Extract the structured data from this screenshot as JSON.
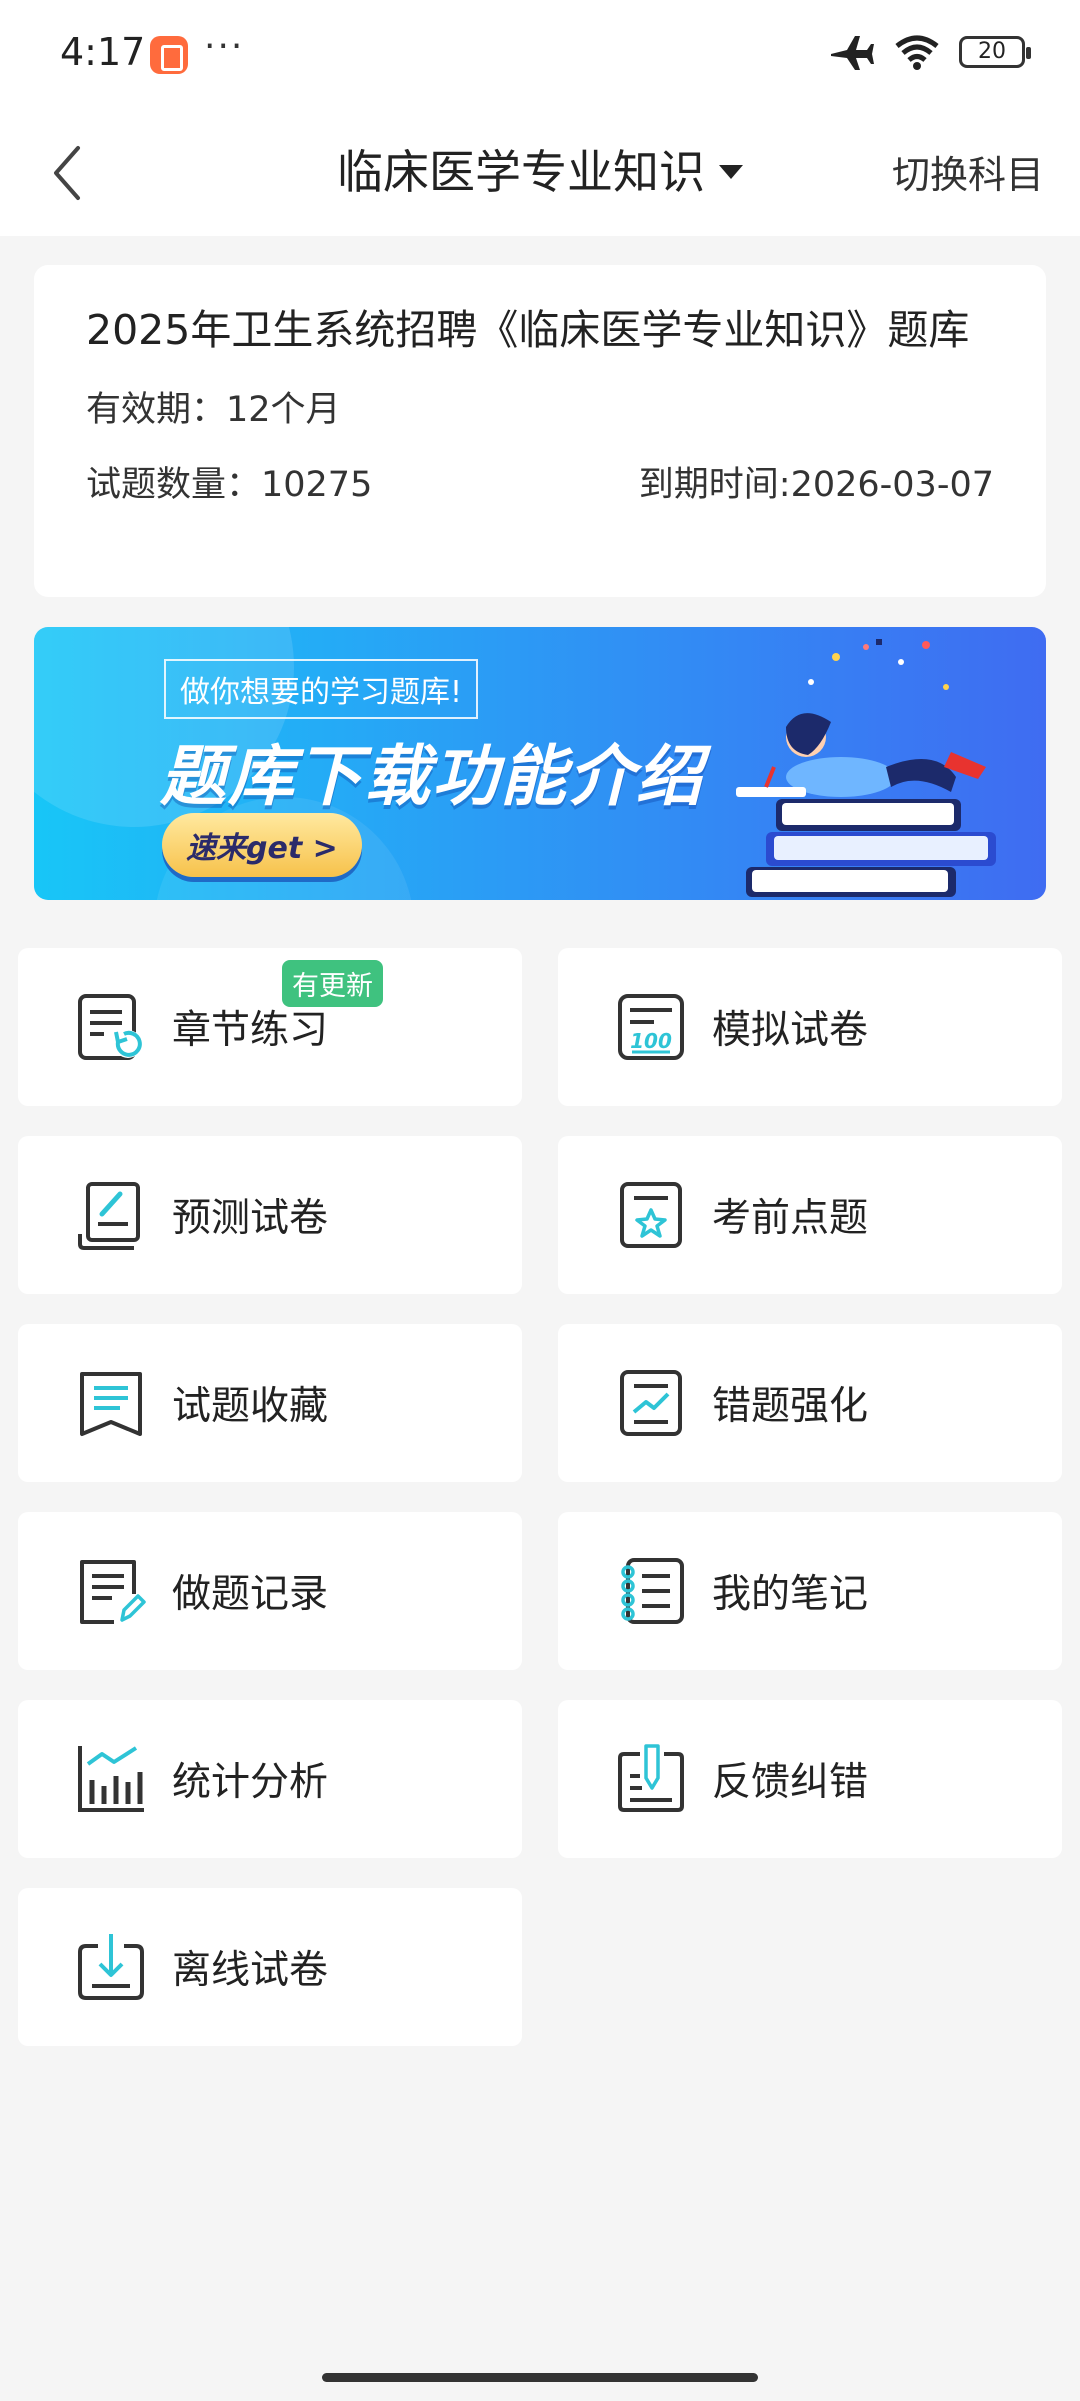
{
  "status_bar": {
    "time": "4:17",
    "dots": "···",
    "battery": "20"
  },
  "nav": {
    "title": "临床医学专业知识",
    "switch_label": "切换科目"
  },
  "info": {
    "title": "2025年卫生系统招聘《临床医学专业知识》题库",
    "validity": "有效期：12个月",
    "count": "试题数量：10275",
    "expiry": "到期时间:2026-03-07"
  },
  "banner": {
    "tag": "做你想要的学习题库!",
    "headline": "题库下载功能介绍",
    "button": "速来get >"
  },
  "tiles": [
    {
      "label": "章节练习",
      "icon": "chapter-practice-icon",
      "badge": "有更新"
    },
    {
      "label": "模拟试卷",
      "icon": "mock-exam-icon"
    },
    {
      "label": "预测试卷",
      "icon": "prediction-exam-icon"
    },
    {
      "label": "考前点题",
      "icon": "pre-exam-tips-icon"
    },
    {
      "label": "试题收藏",
      "icon": "favorites-icon"
    },
    {
      "label": "错题强化",
      "icon": "wrong-questions-icon"
    },
    {
      "label": "做题记录",
      "icon": "practice-record-icon"
    },
    {
      "label": "我的笔记",
      "icon": "notes-icon"
    },
    {
      "label": "统计分析",
      "icon": "statistics-icon"
    },
    {
      "label": "反馈纠错",
      "icon": "feedback-icon"
    },
    {
      "label": "离线试卷",
      "icon": "offline-exam-icon"
    }
  ],
  "colors": {
    "accent": "#2ec4d6",
    "badge": "#3fc27f",
    "background": "#f5f5f5"
  }
}
